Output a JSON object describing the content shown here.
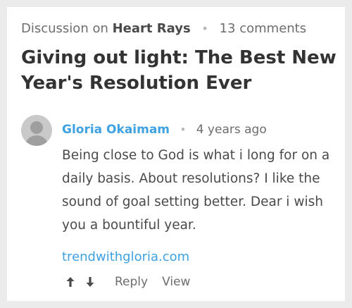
{
  "discussion": {
    "prefix": "Discussion on",
    "community": "Heart Rays",
    "separator": "•",
    "comment_count": "13 comments",
    "title": "Giving out light: The Best New Year's Resolution Ever"
  },
  "comment": {
    "author": "Gloria Okaimam",
    "separator": "•",
    "time": "4 years ago",
    "body": "Being close to God is what i long for on a daily basis. About resolutions? I like the sound of goal setting better. Dear i wish you a bountiful year.",
    "link": "trendwithgloria.com",
    "actions": {
      "upvote_icon": "arrow-up-icon",
      "downvote_icon": "arrow-down-icon",
      "reply_label": "Reply",
      "view_label": "View"
    }
  },
  "colors": {
    "accent": "#3ea1e1",
    "text": "#4a4a4a",
    "muted": "#6d6d6d",
    "background": "#ebebeb",
    "card": "#ffffff"
  }
}
